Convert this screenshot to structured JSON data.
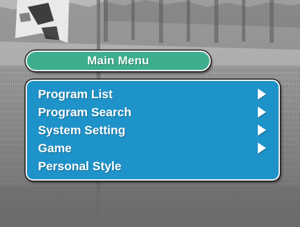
{
  "menu": {
    "title": "Main Menu",
    "items": [
      {
        "label": "Program List",
        "has_submenu": true
      },
      {
        "label": "Program Search",
        "has_submenu": true
      },
      {
        "label": "System Setting",
        "has_submenu": true
      },
      {
        "label": "Game",
        "has_submenu": true
      },
      {
        "label": "Personal Style",
        "has_submenu": false
      }
    ],
    "submenu_icon": "triangle-right-icon"
  },
  "colors": {
    "title_bar": "#3cae8e",
    "panel": "#1e93c9",
    "border": "#f2f2f2",
    "text": "#ffffff"
  }
}
